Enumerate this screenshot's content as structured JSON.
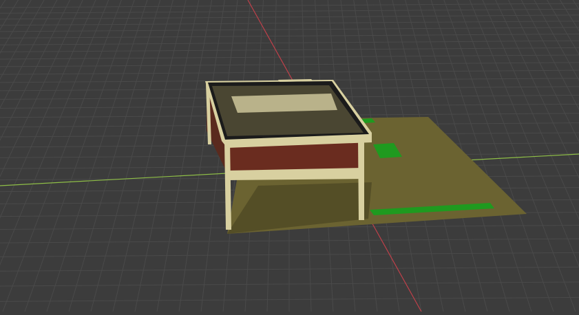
{
  "viewport": {
    "background": "#3c3c3c",
    "grid_color": "#4a4a4a",
    "axis_x_color": "#8fbf47",
    "axis_y_color": "#c0404a"
  },
  "scene": {
    "ground_color": "#6b6331",
    "ground_shadow_color": "#4f4924",
    "grass_color": "#1f9a1f",
    "building_frame_color": "#d8d0a0",
    "building_roof_color": "#4a4632",
    "building_roof_box_color": "#b9b28a",
    "building_glass_color": "#6a2c1f",
    "building_dark_color": "#1b1b1b"
  }
}
